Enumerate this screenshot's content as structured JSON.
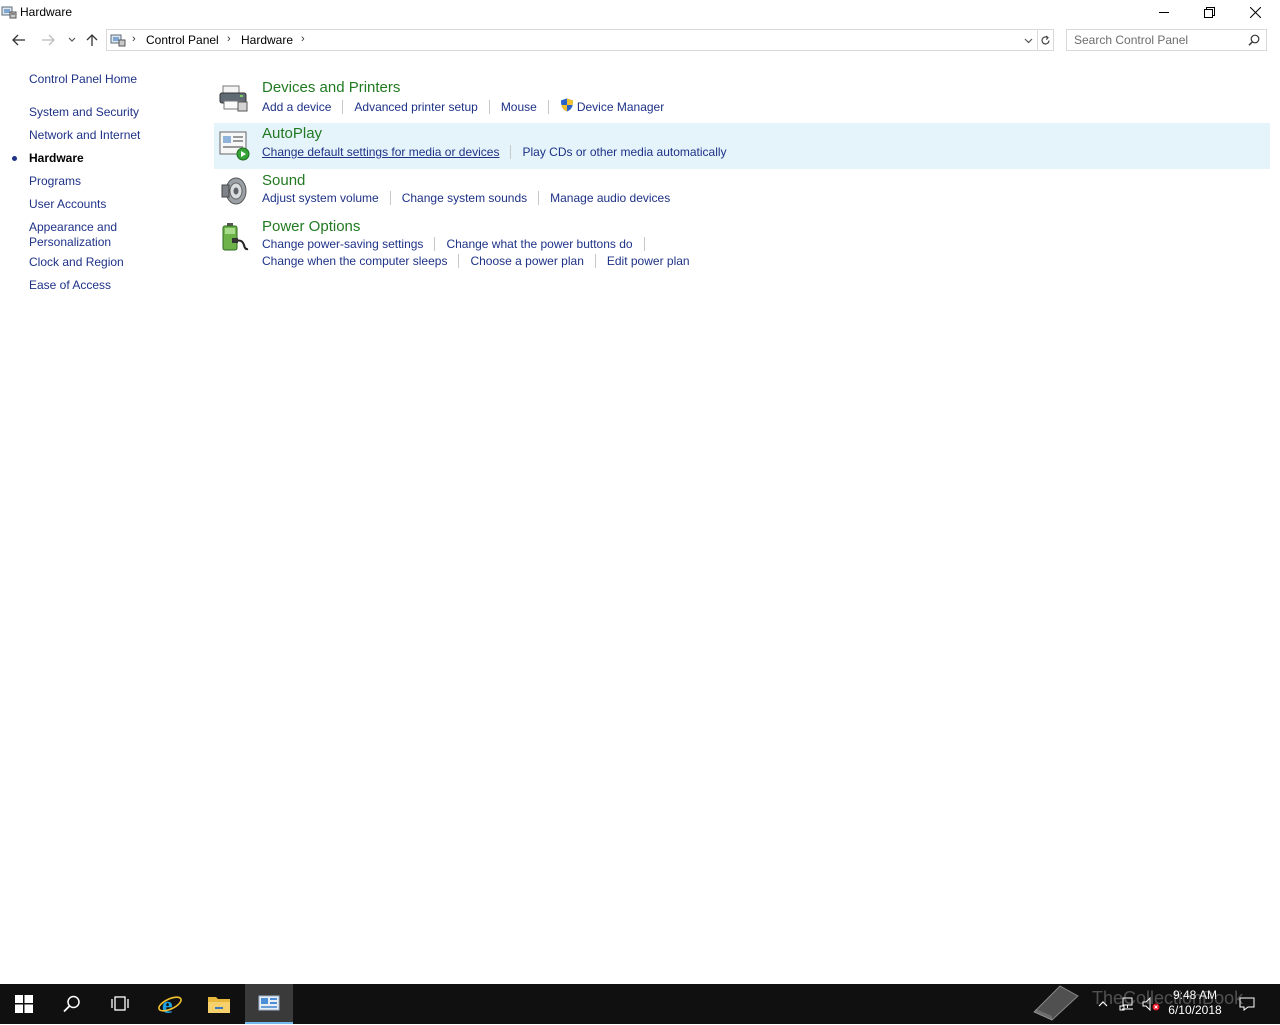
{
  "window": {
    "title": "Hardware"
  },
  "address_bar": {
    "breadcrumbs": [
      "Control Panel",
      "Hardware"
    ]
  },
  "search": {
    "placeholder": "Search Control Panel"
  },
  "sidebar": {
    "home": "Control Panel Home",
    "items": [
      {
        "label": "System and Security"
      },
      {
        "label": "Network and Internet"
      },
      {
        "label": "Hardware",
        "current": true
      },
      {
        "label": "Programs"
      },
      {
        "label": "User Accounts"
      },
      {
        "label": "Appearance and"
      },
      {
        "label": "Personalization"
      },
      {
        "label": "Clock and Region"
      },
      {
        "label": "Ease of Access"
      }
    ]
  },
  "categories": [
    {
      "title": "Devices and Printers",
      "icon": "printer-icon",
      "links": [
        "Add a device",
        "Advanced printer setup",
        "Mouse",
        "Device Manager"
      ]
    },
    {
      "title": "AutoPlay",
      "icon": "autoplay-icon",
      "highlighted": true,
      "links": [
        "Change default settings for media or devices",
        "Play CDs or other media automatically"
      ]
    },
    {
      "title": "Sound",
      "icon": "speaker-icon",
      "links": [
        "Adjust system volume",
        "Change system sounds",
        "Manage audio devices"
      ]
    },
    {
      "title": "Power Options",
      "icon": "battery-icon",
      "links": [
        "Change power-saving settings",
        "Change what the power buttons do",
        "Change when the computer sleeps",
        "Choose a power plan",
        "Edit power plan"
      ]
    }
  ],
  "taskbar": {
    "time": "9:48 AM",
    "date": "6/10/2018",
    "watermark": "TheCollectionBook"
  },
  "colors": {
    "link": "#1e3287",
    "category_title": "#217a21",
    "highlight": "#e5f3fb",
    "taskbar": "#101010"
  }
}
